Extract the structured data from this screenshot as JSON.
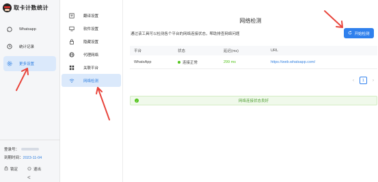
{
  "brand": {
    "title": "取卡计数统计"
  },
  "sidebar": {
    "items": [
      {
        "label": "Whatsapp",
        "icon": "whatsapp-icon"
      },
      {
        "label": "统计记录",
        "icon": "clock-icon"
      },
      {
        "label": "更多设置",
        "icon": "gear-icon"
      }
    ],
    "account_label": "登录号：",
    "expire_label": "到期时间：",
    "expire_date": "2023-11-04",
    "lock_label": "锁定",
    "logout_label": "退出",
    "collapse_glyph": "<"
  },
  "menu": {
    "items": [
      {
        "label": "翻译设置",
        "icon": "translate-icon"
      },
      {
        "label": "软件设置",
        "icon": "monitor-icon"
      },
      {
        "label": "隐藏设置",
        "icon": "lock-icon"
      },
      {
        "label": "代理网络",
        "icon": "globe-icon"
      },
      {
        "label": "关联平台",
        "icon": "grid-icon"
      },
      {
        "label": "网络检测",
        "icon": "wifi-icon"
      }
    ]
  },
  "main": {
    "title": "网络检测",
    "description": "通过该工具可以检测各个平台的网络连接状态，帮助排查网络问题",
    "start_button": "开始检测",
    "table": {
      "headers": [
        "平台",
        "状态",
        "延迟(ms)",
        "URL"
      ],
      "rows": [
        {
          "platform": "WhatsApp",
          "status": "连接正常",
          "latency": "299 ms",
          "url": "https://web.whatsapp.com/"
        }
      ]
    },
    "pager": {
      "prev": "‹",
      "page": "1",
      "next": "›"
    },
    "result": "网络连接状态良好"
  },
  "colors": {
    "accent": "#2f80ed",
    "success": "#52c41a",
    "annotation": "#e8453c"
  }
}
